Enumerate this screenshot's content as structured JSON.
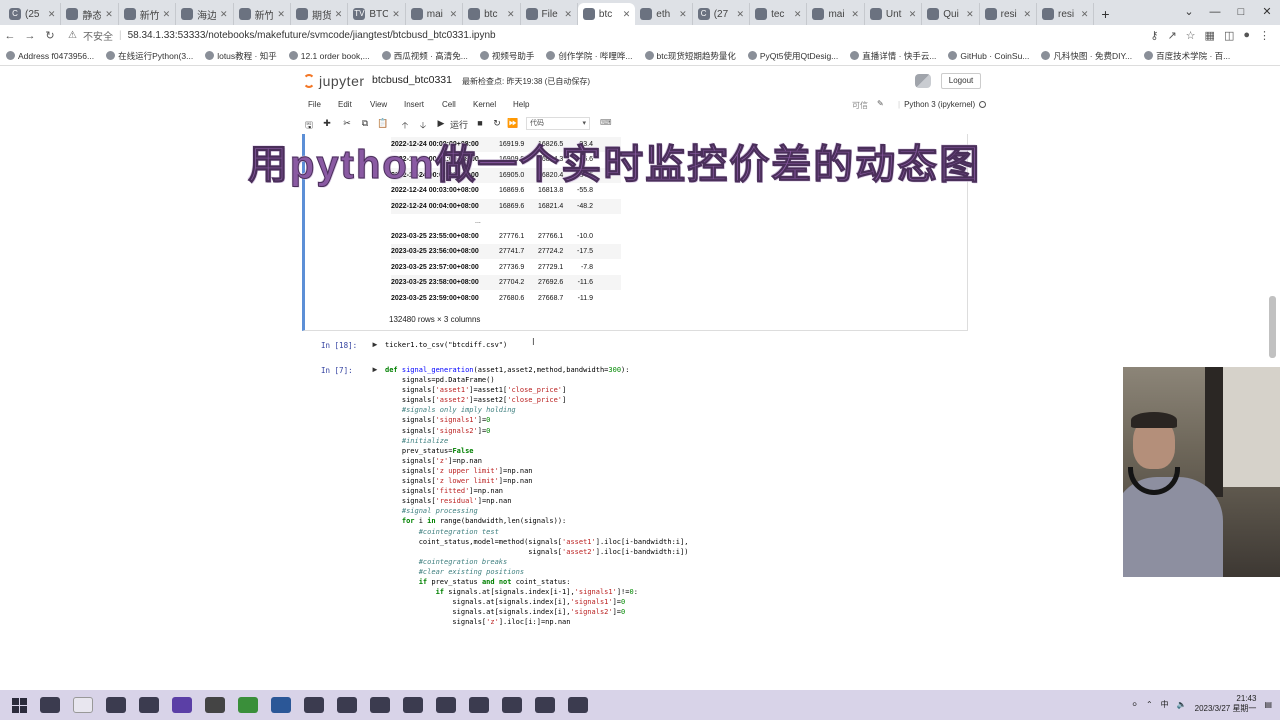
{
  "browser": {
    "tabs": [
      {
        "icon": "C",
        "label": "(25"
      },
      {
        "icon": "",
        "label": "静态"
      },
      {
        "icon": "",
        "label": "新竹"
      },
      {
        "icon": "",
        "label": "海边"
      },
      {
        "icon": "",
        "label": "新竹"
      },
      {
        "icon": "",
        "label": "期货"
      },
      {
        "icon": "TV",
        "label": "BTC"
      },
      {
        "icon": "",
        "label": "mai"
      },
      {
        "icon": "",
        "label": "btc"
      },
      {
        "icon": "",
        "label": "File"
      },
      {
        "icon": "",
        "label": "btc"
      },
      {
        "icon": "",
        "label": "eth"
      },
      {
        "icon": "C",
        "label": "(27"
      },
      {
        "icon": "",
        "label": "tec"
      },
      {
        "icon": "",
        "label": "mai"
      },
      {
        "icon": "",
        "label": "Unt"
      },
      {
        "icon": "",
        "label": "Qui"
      },
      {
        "icon": "",
        "label": "resi"
      },
      {
        "icon": "",
        "label": "resi"
      }
    ],
    "new_tab": "+",
    "security_label": "不安全",
    "url": "58.34.1.33:53333/notebooks/makefuture/svmcode/jiangtest/btcbusd_btc0331.ipynb",
    "bookmarks": [
      "Address f0473956...",
      "在线运行Python(3...",
      "lotus教程 · 知乎",
      "12.1 order book,...",
      "西瓜视频 · 高清免...",
      "视频号助手",
      "创作学院 · 哔哩哗...",
      "btc现货短期趋势量化",
      "PyQt5使用QtDesig...",
      "直播详情 · 快手云...",
      "GitHub · CoinSu...",
      "凡科快图 · 免费DIY...",
      "百度技术学院 · 百..."
    ]
  },
  "jupyter": {
    "logo_text": "jupyter",
    "notebook_name": "btcbusd_btc0331",
    "checkpoint": "最新检查点: 昨天19:38  (已自动保存)",
    "logout": "Logout",
    "menus": [
      "File",
      "Edit",
      "View",
      "Insert",
      "Cell",
      "Kernel",
      "Help"
    ],
    "trusted": "可信",
    "kernel_name": "Python 3 (ipykernel)",
    "run_label": "运行",
    "cell_type": "代码"
  },
  "overlay_title": "用python做一个实时监控价差的动态图",
  "dataframe": {
    "top_rows": [
      {
        "index": "2022-12-24 00:00:00+08:00",
        "c1": "16919.9",
        "c2": "16826.5",
        "c3": "-93.4"
      },
      {
        "index": "2022-12-24 00:01:00+08:00",
        "c1": "16909.9",
        "c2": "16824.3",
        "c3": "-85.6"
      },
      {
        "index": "2022-12-24 00:02:00+08:00",
        "c1": "16905.0",
        "c2": "16820.4",
        "c3": "-84.6"
      },
      {
        "index": "2022-12-24 00:03:00+08:00",
        "c1": "16869.6",
        "c2": "16813.8",
        "c3": "-55.8"
      },
      {
        "index": "2022-12-24 00:04:00+08:00",
        "c1": "16869.6",
        "c2": "16821.4",
        "c3": "-48.2"
      }
    ],
    "ellipsis": "...",
    "bottom_rows": [
      {
        "index": "2023-03-25 23:55:00+08:00",
        "c1": "27776.1",
        "c2": "27766.1",
        "c3": "-10.0"
      },
      {
        "index": "2023-03-25 23:56:00+08:00",
        "c1": "27741.7",
        "c2": "27724.2",
        "c3": "-17.5"
      },
      {
        "index": "2023-03-25 23:57:00+08:00",
        "c1": "27736.9",
        "c2": "27729.1",
        "c3": "-7.8"
      },
      {
        "index": "2023-03-25 23:58:00+08:00",
        "c1": "27704.2",
        "c2": "27692.6",
        "c3": "-11.6"
      },
      {
        "index": "2023-03-25 23:59:00+08:00",
        "c1": "27680.6",
        "c2": "27668.7",
        "c3": "-11.9"
      }
    ],
    "shape": "132480 rows × 3 columns"
  },
  "cells": {
    "c18_prompt": "In  [18]:",
    "c18_code": "ticker1.to_csv(\"btcdiff.csv\")",
    "c7_prompt": "In  [7]:"
  },
  "code_lines": [
    "def signal_generation(asset1,asset2,method,bandwidth=300):",
    "",
    "    signals=pd.DataFrame()",
    "    signals['asset1']=asset1['close_price']",
    "    signals['asset2']=asset2['close_price']",
    "",
    "    #signals only imply holding",
    "    signals['signals1']=0",
    "    signals['signals2']=0",
    "",
    "    #initialize",
    "    prev_status=False",
    "    signals['z']=np.nan",
    "    signals['z upper limit']=np.nan",
    "    signals['z lower limit']=np.nan",
    "    signals['fitted']=np.nan",
    "    signals['residual']=np.nan",
    "",
    "    #signal processing",
    "    for i in range(bandwidth,len(signals)):",
    "",
    "        #cointegration test",
    "        coint_status,model=method(signals['asset1'].iloc[i-bandwidth:i],",
    "                                  signals['asset2'].iloc[i-bandwidth:i])",
    "",
    "        #cointegration breaks",
    "        #clear existing positions",
    "        if prev_status and not coint_status:",
    "            if signals.at[signals.index[i-1],'signals1']!=0:",
    "                signals.at[signals.index[i],'signals1']=0",
    "                signals.at[signals.index[i],'signals2']=0",
    "                signals['z'].iloc[i:]=np.nan"
  ],
  "taskbar": {
    "time": "21:43",
    "date": "2023/3/27 星期一"
  },
  "colors": {
    "overlay": "#8a5aa3",
    "cell_selected_border": "#5c8fd6",
    "prompt": "#303f9f"
  }
}
